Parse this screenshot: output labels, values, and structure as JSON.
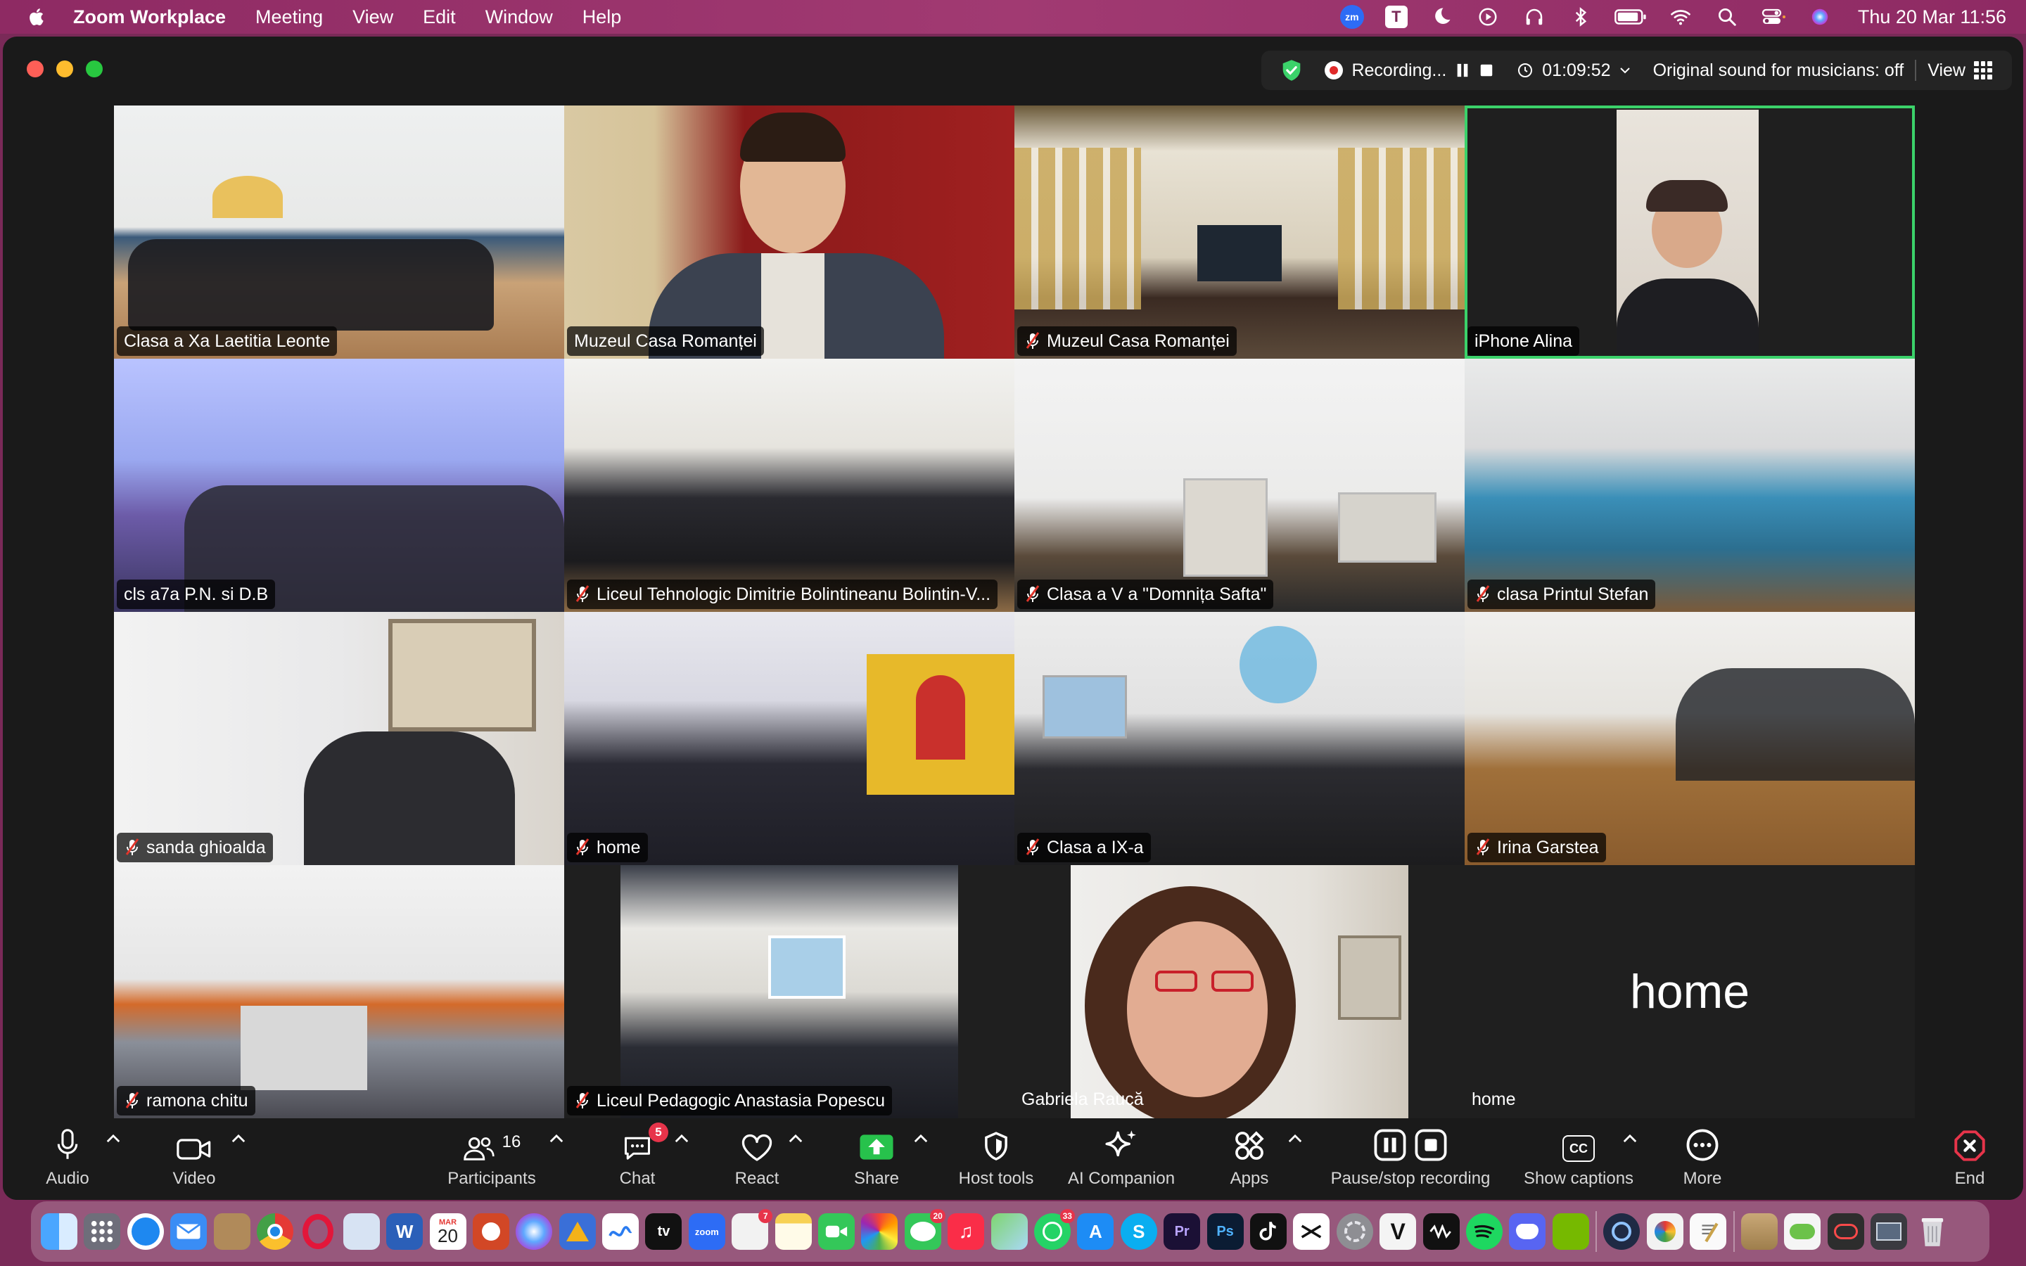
{
  "menubar": {
    "app_name": "Zoom Workplace",
    "menus": [
      "Meeting",
      "View",
      "Edit",
      "Window",
      "Help"
    ],
    "zoom_icon_text": "zm",
    "t_icon_text": "T",
    "clock": "Thu 20 Mar  11:56"
  },
  "statusbar": {
    "recording_label": "Recording...",
    "timer": "01:09:52",
    "original_sound": "Original sound for musicians: off",
    "view_label": "View"
  },
  "tiles": [
    {
      "name": "Clasa a Xa Laetitia Leonte",
      "muted": false
    },
    {
      "name": "Muzeul Casa Romanței",
      "muted": false
    },
    {
      "name": "Muzeul Casa Romanței",
      "muted": true
    },
    {
      "name": "iPhone Alina",
      "muted": false,
      "active": true
    },
    {
      "name": "cls a7a P.N. si D.B",
      "muted": false
    },
    {
      "name": "Liceul Tehnologic Dimitrie Bolintineanu Bolintin-V...",
      "muted": true
    },
    {
      "name": "Clasa a V a \"Domnița Safta\"",
      "muted": true
    },
    {
      "name": "clasa Printul Stefan",
      "muted": true
    },
    {
      "name": "sanda ghioalda",
      "muted": true
    },
    {
      "name": "home",
      "muted": true
    },
    {
      "name": "Clasa a IX-a",
      "muted": true
    },
    {
      "name": "Irina Garstea",
      "muted": true
    },
    {
      "name": "ramona chitu",
      "muted": true
    },
    {
      "name": "Liceul Pedagogic Anastasia Popescu",
      "muted": true
    },
    {
      "name": "Gabriela Raucă",
      "muted": false
    },
    {
      "name": "home",
      "muted": false,
      "display_name": "home"
    }
  ],
  "toolbar": {
    "audio": "Audio",
    "video": "Video",
    "participants": "Participants",
    "participants_count": "16",
    "chat": "Chat",
    "chat_badge": "5",
    "react": "React",
    "share": "Share",
    "host_tools": "Host tools",
    "ai_companion": "AI Companion",
    "apps": "Apps",
    "pause_stop": "Pause/stop recording",
    "captions": "Show captions",
    "captions_icon_text": "CC",
    "more": "More",
    "end": "End"
  },
  "dock": {
    "calendar_month": "MAR",
    "calendar_day": "20",
    "zoom_text": "zoom",
    "tv_text": "tv",
    "word_text": "W",
    "pr_text": "Pr",
    "ps_text": "Ps",
    "v_text": "V",
    "skype_text": "S",
    "badges": {
      "launchpad": "7",
      "messages": "20",
      "whatsapp": "33"
    }
  },
  "colors": {
    "menubar": "#8e2a63",
    "window_bg": "#1a1a1a",
    "active_speaker": "#3bd26a",
    "share_green": "#27c24c",
    "end_red": "#e7344a",
    "mute_red": "#e0352b"
  }
}
